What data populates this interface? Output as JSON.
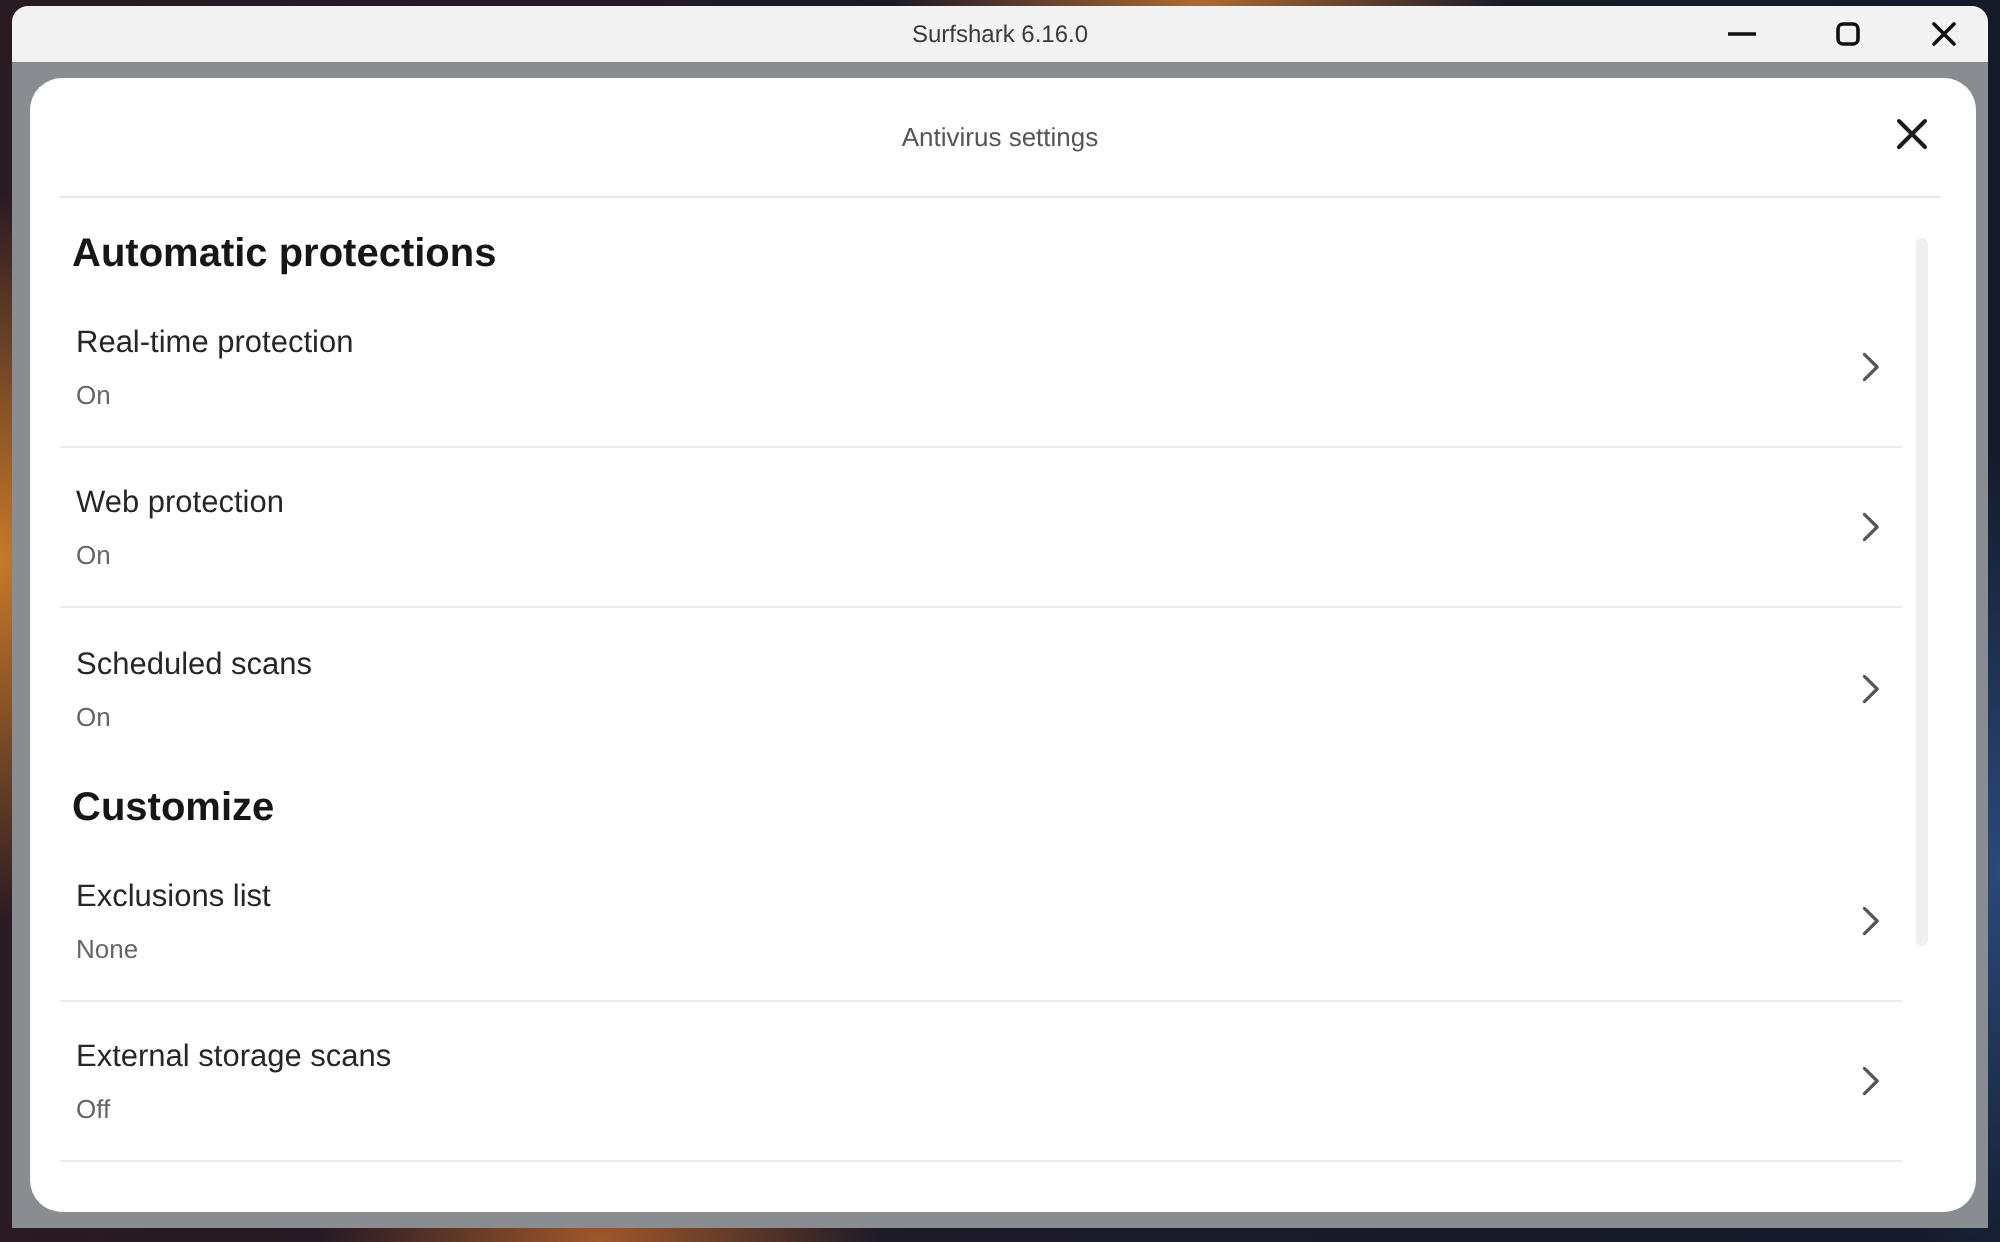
{
  "window": {
    "title": "Surfshark 6.16.0"
  },
  "dialog": {
    "title": "Antivirus settings"
  },
  "sections": [
    {
      "heading": "Automatic protections",
      "items": [
        {
          "label": "Real-time protection",
          "value": "On"
        },
        {
          "label": "Web protection",
          "value": "On"
        },
        {
          "label": "Scheduled scans",
          "value": "On"
        }
      ]
    },
    {
      "heading": "Customize",
      "items": [
        {
          "label": "Exclusions list",
          "value": "None"
        },
        {
          "label": "External storage scans",
          "value": "Off"
        }
      ]
    }
  ]
}
